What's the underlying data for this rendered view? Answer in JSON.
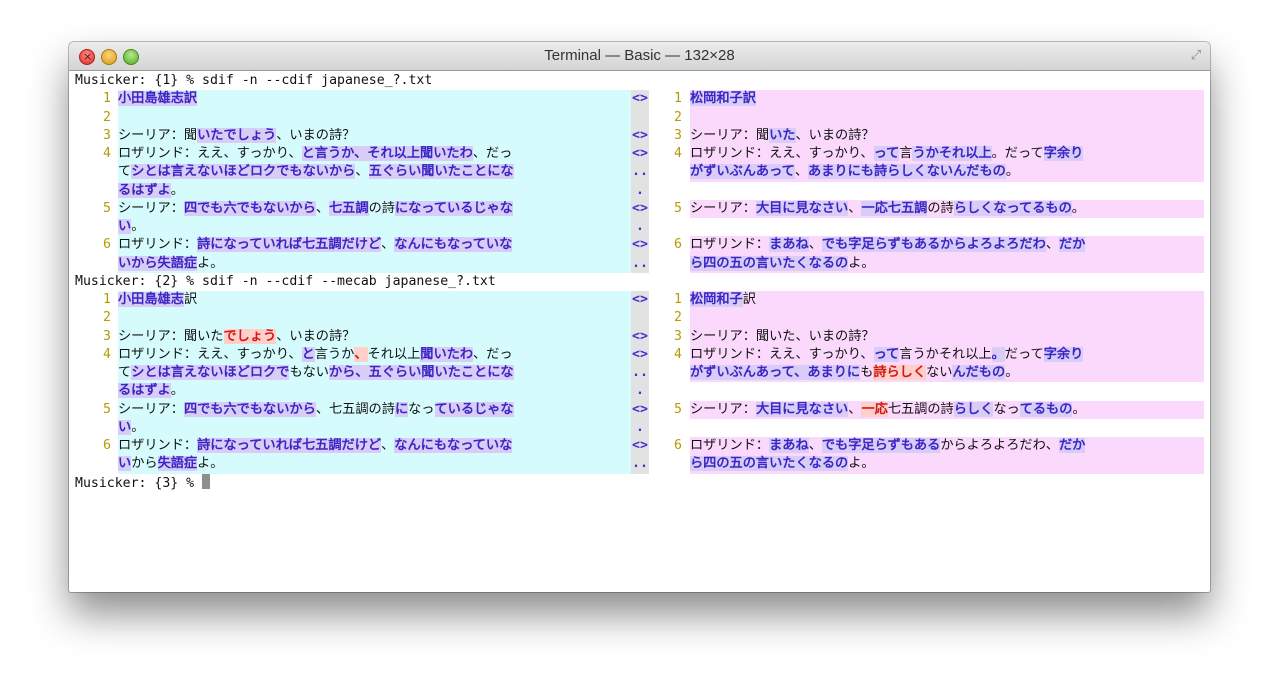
{
  "window": {
    "title": "Terminal — Basic — 132×28",
    "colors": {
      "left_bg": "#d6fbfc",
      "right_bg": "#fbd9fc",
      "highlight": "#3a26c4",
      "delete": "#d01818"
    }
  },
  "terminal": {
    "prompt1": "Musicker: {1} % sdif -n --cdif japanese_?.txt",
    "prompt2": "Musicker: {2} % sdif -n --cdif --mecab japanese_?.txt",
    "prompt3": "Musicker: {3} % ",
    "block1": [
      {
        "ln": "1",
        "mark": "<>",
        "rln": "1",
        "left": [
          [
            "小田島雄志訳",
            "h"
          ]
        ],
        "right": [
          [
            "松岡和子訳",
            "h"
          ]
        ]
      },
      {
        "ln": "2",
        "mark": "",
        "rln": "2",
        "left": [],
        "right": []
      },
      {
        "ln": "3",
        "mark": "<>",
        "rln": "3",
        "left": [
          [
            "シーリア：聞",
            ""
          ],
          [
            "いたでしょう",
            "h"
          ],
          [
            "、いまの詩？",
            ""
          ]
        ],
        "right": [
          [
            "シーリア：聞",
            ""
          ],
          [
            "いた",
            "h"
          ],
          [
            "、いまの詩？",
            ""
          ]
        ]
      },
      {
        "ln": "4",
        "mark": "<>",
        "rln": "4",
        "left": [
          [
            "ロザリンド：ええ、すっかり、",
            ""
          ],
          [
            "と言うか、それ以上聞いたわ",
            "h"
          ],
          [
            "、だっ",
            ""
          ]
        ],
        "right": [
          [
            "ロザリンド：ええ、すっかり、",
            ""
          ],
          [
            "って",
            "h"
          ],
          [
            "言",
            ""
          ],
          [
            "うかそれ以上",
            "h"
          ],
          [
            "。だって",
            ""
          ],
          [
            "字余り",
            "h"
          ]
        ]
      },
      {
        "ln": "",
        "mark": "..",
        "rln": "",
        "left": [
          [
            "て",
            ""
          ],
          [
            "シとは言えないほどロクでもないから",
            "h"
          ],
          [
            "、",
            ""
          ],
          [
            "五ぐらい聞いたことにな",
            "h"
          ]
        ],
        "right": [
          [
            "がずいぶんあって",
            "h"
          ],
          [
            "、",
            ""
          ],
          [
            "あまりにも詩らしくないんだもの",
            "h"
          ],
          [
            "。",
            ""
          ]
        ]
      },
      {
        "ln": "",
        "mark": ".",
        "rln": "",
        "left": [
          [
            "るはずよ",
            "h"
          ],
          [
            "。",
            ""
          ]
        ],
        "right": null
      },
      {
        "ln": "5",
        "mark": "<>",
        "rln": "5",
        "left": [
          [
            "シーリア：",
            ""
          ],
          [
            "四でも六でもないから",
            "h"
          ],
          [
            "、",
            ""
          ],
          [
            "七五調",
            "h"
          ],
          [
            "の詩",
            ""
          ],
          [
            "になっているじゃな",
            "h"
          ]
        ],
        "right": [
          [
            "シーリア：",
            ""
          ],
          [
            "大目に見なさい",
            "h"
          ],
          [
            "、",
            ""
          ],
          [
            "一応七五調",
            "h"
          ],
          [
            "の詩",
            ""
          ],
          [
            "らしくなってるもの",
            "h"
          ],
          [
            "。",
            ""
          ]
        ]
      },
      {
        "ln": "",
        "mark": ".",
        "rln": "",
        "left": [
          [
            "い",
            "h"
          ],
          [
            "。",
            ""
          ]
        ],
        "right": null
      },
      {
        "ln": "6",
        "mark": "<>",
        "rln": "6",
        "left": [
          [
            "ロザリンド：",
            ""
          ],
          [
            "詩になっていれば七五調だけど",
            "h"
          ],
          [
            "、",
            ""
          ],
          [
            "なんにもなっていな",
            "h"
          ]
        ],
        "right": [
          [
            "ロザリンド：",
            ""
          ],
          [
            "まあね",
            "h"
          ],
          [
            "、",
            ""
          ],
          [
            "でも字足らずもあるからよろよろだわ",
            "h"
          ],
          [
            "、",
            ""
          ],
          [
            "だか",
            "h"
          ]
        ]
      },
      {
        "ln": "",
        "mark": "..",
        "rln": "",
        "left": [
          [
            "いから失語症",
            "h"
          ],
          [
            "よ。",
            ""
          ]
        ],
        "right": [
          [
            "ら四の五の言いたくなるの",
            "h"
          ],
          [
            "よ。",
            ""
          ]
        ]
      }
    ],
    "block2": [
      {
        "ln": "1",
        "mark": "<>",
        "rln": "1",
        "left": [
          [
            "小田島雄志",
            "h"
          ],
          [
            "訳",
            ""
          ]
        ],
        "right": [
          [
            "松岡和子",
            "h"
          ],
          [
            "訳",
            ""
          ]
        ]
      },
      {
        "ln": "2",
        "mark": "",
        "rln": "2",
        "left": [],
        "right": []
      },
      {
        "ln": "3",
        "mark": "<>",
        "rln": "3",
        "left": [
          [
            "シーリア：聞いた",
            ""
          ],
          [
            "でしょう",
            "d"
          ],
          [
            "、いまの詩？",
            ""
          ]
        ],
        "right": [
          [
            "シーリア：聞いた、いまの詩？",
            ""
          ]
        ]
      },
      {
        "ln": "4",
        "mark": "<>",
        "rln": "4",
        "left": [
          [
            "ロザリンド：ええ、すっかり、",
            ""
          ],
          [
            "と",
            "h"
          ],
          [
            "言うか",
            ""
          ],
          [
            "、",
            "d"
          ],
          [
            "それ以上",
            ""
          ],
          [
            "聞いたわ",
            "h"
          ],
          [
            "、だっ",
            ""
          ]
        ],
        "right": [
          [
            "ロザリンド：ええ、すっかり、",
            ""
          ],
          [
            "って",
            "h"
          ],
          [
            "言うかそれ以上",
            ""
          ],
          [
            "。",
            "h"
          ],
          [
            "だって",
            ""
          ],
          [
            "字余り",
            "h"
          ]
        ]
      },
      {
        "ln": "",
        "mark": "..",
        "rln": "",
        "left": [
          [
            "て",
            ""
          ],
          [
            "シとは言えないほどロクで",
            "h"
          ],
          [
            "もない",
            ""
          ],
          [
            "から、五ぐらい聞いたことにな",
            "h"
          ]
        ],
        "right": [
          [
            "がずいぶんあって、あまりに",
            "h"
          ],
          [
            "も",
            ""
          ],
          [
            "詩らしく",
            "d"
          ],
          [
            "ない",
            ""
          ],
          [
            "んだもの",
            "h"
          ],
          [
            "。",
            ""
          ]
        ]
      },
      {
        "ln": "",
        "mark": ".",
        "rln": "",
        "left": [
          [
            "るはずよ",
            "h"
          ],
          [
            "。",
            ""
          ]
        ],
        "right": null
      },
      {
        "ln": "5",
        "mark": "<>",
        "rln": "5",
        "left": [
          [
            "シーリア：",
            ""
          ],
          [
            "四でも六でもないから",
            "h"
          ],
          [
            "、七五調の詩",
            ""
          ],
          [
            "に",
            "h"
          ],
          [
            "なっ",
            ""
          ],
          [
            "ているじゃな",
            "h"
          ]
        ],
        "right": [
          [
            "シーリア：",
            ""
          ],
          [
            "大目に見なさい",
            "h"
          ],
          [
            "、",
            ""
          ],
          [
            "一応",
            "d"
          ],
          [
            "七五調の詩",
            ""
          ],
          [
            "らしく",
            "h"
          ],
          [
            "なっ",
            ""
          ],
          [
            "てるもの",
            "h"
          ],
          [
            "。",
            ""
          ]
        ]
      },
      {
        "ln": "",
        "mark": ".",
        "rln": "",
        "left": [
          [
            "い",
            "h"
          ],
          [
            "。",
            ""
          ]
        ],
        "right": null
      },
      {
        "ln": "6",
        "mark": "<>",
        "rln": "6",
        "left": [
          [
            "ロザリンド：",
            ""
          ],
          [
            "詩になっていれば七五調だけど",
            "h"
          ],
          [
            "、",
            ""
          ],
          [
            "なんにもなっていな",
            "h"
          ]
        ],
        "right": [
          [
            "ロザリンド：",
            ""
          ],
          [
            "まあね",
            "h"
          ],
          [
            "、",
            ""
          ],
          [
            "でも字足らずもある",
            "h"
          ],
          [
            "からよろよろだわ、",
            ""
          ],
          [
            "だか",
            "h"
          ]
        ]
      },
      {
        "ln": "",
        "mark": "..",
        "rln": "",
        "left": [
          [
            "い",
            "h"
          ],
          [
            "から",
            ""
          ],
          [
            "失語症",
            "h"
          ],
          [
            "よ。",
            ""
          ]
        ],
        "right": [
          [
            "ら四の五の言いたくなるの",
            "h"
          ],
          [
            "よ。",
            ""
          ]
        ]
      }
    ]
  }
}
